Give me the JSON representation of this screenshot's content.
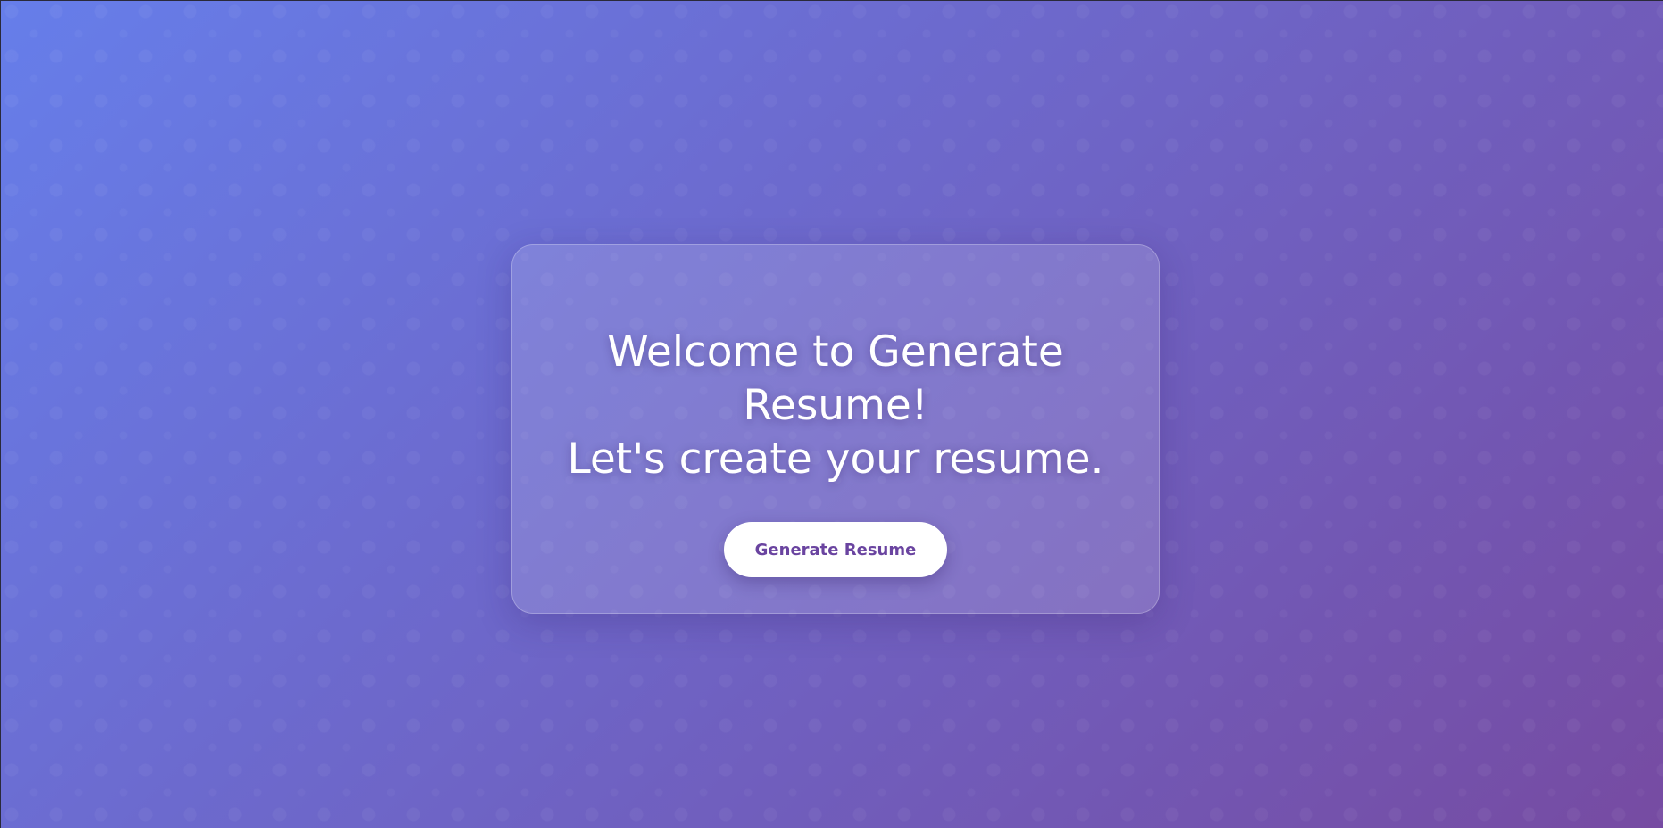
{
  "colors": {
    "gradient_start": "#667eea",
    "gradient_end": "#764ba2",
    "button_text": "#6a44a0"
  },
  "hero": {
    "title_line1": "Welcome to Generate Resume!",
    "title_line2": "Let's create your resume.",
    "button_label": "Generate Resume"
  }
}
